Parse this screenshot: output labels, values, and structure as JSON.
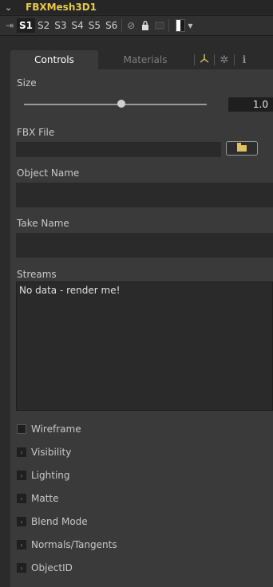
{
  "tool": {
    "name": "FBXMesh3D1"
  },
  "toolbar": {
    "slots": [
      "S1",
      "S2",
      "S3",
      "S4",
      "S5",
      "S6"
    ],
    "active_slot": "S1"
  },
  "tabs": {
    "controls": "Controls",
    "materials": "Materials"
  },
  "size": {
    "label": "Size",
    "value": "1.0"
  },
  "fbx_file": {
    "label": "FBX File",
    "value": ""
  },
  "object_name": {
    "label": "Object Name",
    "value": ""
  },
  "take_name": {
    "label": "Take Name",
    "value": ""
  },
  "streams": {
    "label": "Streams",
    "text": "No data - render me!"
  },
  "wireframe": {
    "label": "Wireframe",
    "checked": false
  },
  "sections": [
    "Visibility",
    "Lighting",
    "Matte",
    "Blend Mode",
    "Normals/Tangents",
    "ObjectID"
  ],
  "colors": {
    "title": "#e8c84a",
    "panel": "#3a3a3a",
    "field": "#2a2a2a"
  }
}
